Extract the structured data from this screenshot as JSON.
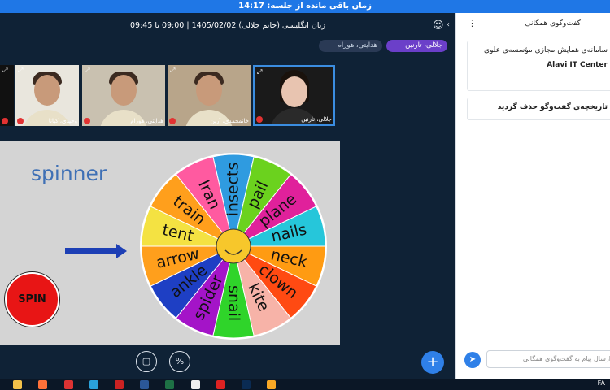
{
  "topbar": {
    "remaining": "زمان باقی مانده از جلسه: 14:17"
  },
  "session": {
    "title": "زبان انگلیسی (خانم جلالی) 1405/02/02 | 09:00 تا 09:45"
  },
  "pills": {
    "me": "جلالی، تارنین",
    "other": "هدایتی، هورام"
  },
  "tiles": [
    {
      "name": ""
    },
    {
      "name": "وحیدی، کیانا"
    },
    {
      "name": "هدایتی، هورام"
    },
    {
      "name": "خانمحمدی، آرین"
    },
    {
      "name": "جلالی، تارنین"
    }
  ],
  "slide": {
    "title": "spinner",
    "spin_label": "SPIN",
    "wheel_words": [
      "insects",
      "pail",
      "plane",
      "nails",
      "neck",
      "clown",
      "kite",
      "snail",
      "spider",
      "ankle",
      "arrow",
      "tent",
      "train",
      "Iran"
    ],
    "wheel_colors": [
      "#2f9be0",
      "#6bd21e",
      "#e0219b",
      "#26c6da",
      "#ff9b12",
      "#ff4a12",
      "#f7b3a8",
      "#2fd42a",
      "#a414c8",
      "#1e3fc4",
      "#ff9f1c",
      "#f4e242",
      "#ff9f1c",
      "#ff5aa0"
    ]
  },
  "controls": {
    "share_icon": "screen-share-icon",
    "exit_icon": "percent-icon"
  },
  "chat": {
    "title": "گفت‌وگوی همگانی",
    "msg1_line1": "سامانه‌ی همایش مجازی مؤسسه‌ی علوی",
    "msg1_line2": "Alavi IT Center",
    "msg2": "تاریخچه‌ی گفت‌وگو حذف گردید",
    "input_placeholder": "ارسال پیام به گفت‌وگوی همگانی"
  },
  "taskbar": {
    "tray_text": "FA"
  },
  "colors": {
    "accent": "#2f80e8",
    "topbar": "#1f77e6",
    "pill_me": "#6b3fc9"
  }
}
